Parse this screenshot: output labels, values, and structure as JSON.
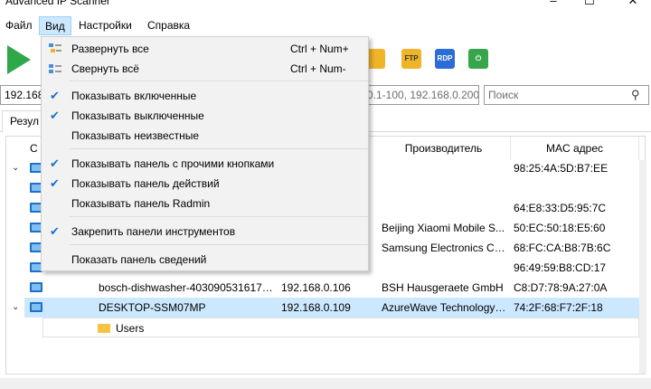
{
  "window": {
    "title": "Advanced IP Scanner"
  },
  "menu": {
    "items": [
      "Файл",
      "Вид",
      "Настройки",
      "Справка"
    ]
  },
  "address": {
    "value": "192.168",
    "hint": "0.1-100, 192.168.0.200",
    "search_placeholder": "Поиск"
  },
  "tabs": [
    "Резул"
  ],
  "table": {
    "headers": [
      "С",
      "",
      "",
      "Производитель",
      "MAC адрес"
    ],
    "rows": [
      {
        "name": "",
        "ip": "",
        "vendor": "",
        "mac": "98:25:4A:5D:B7:EE"
      },
      {
        "name": "",
        "ip": "",
        "vendor": "",
        "mac": ""
      },
      {
        "name": "",
        "ip": "",
        "vendor": "",
        "mac": "64:E8:33:D5:95:7C"
      },
      {
        "name": "",
        "ip": "",
        "vendor": "Beijing Xiaomi Mobile S...",
        "mac": "50:EC:50:18:E5:60"
      },
      {
        "name": "",
        "ip": "",
        "vendor": "Samsung Electronics Co...",
        "mac": "68:FC:CA:B8:7B:6C"
      },
      {
        "name": "",
        "ip": "",
        "vendor": "",
        "mac": "96:49:59:B8:CD:17"
      },
      {
        "name": "bosch-dishwasher-4030905316170...",
        "ip": "192.168.0.106",
        "vendor": "BSH Hausgeraete GmbH",
        "mac": "C8:D7:78:9A:27:0A"
      },
      {
        "name": "DESKTOP-SSM07MP",
        "ip": "192.168.0.109",
        "vendor": "AzureWave Technology I...",
        "mac": "74:2F:68:F7:2F:18"
      }
    ],
    "child": {
      "name": "Users"
    }
  },
  "dropdown": {
    "items": [
      {
        "label": "Развернуть все",
        "shortcut": "Ctrl + Num+",
        "checked": false,
        "icon": "expand-icon"
      },
      {
        "label": "Свернуть всё",
        "shortcut": "Ctrl + Num-",
        "checked": false,
        "icon": "collapse-icon"
      },
      {
        "label": "Показывать включенные",
        "shortcut": "",
        "checked": true
      },
      {
        "label": "Показывать выключенные",
        "shortcut": "",
        "checked": true
      },
      {
        "label": "Показывать неизвестные",
        "shortcut": "",
        "checked": false
      },
      {
        "label": "Показывать панель с прочими кнопками",
        "shortcut": "",
        "checked": true
      },
      {
        "label": "Показывать панель действий",
        "shortcut": "",
        "checked": true
      },
      {
        "label": "Показывать панель Radmin",
        "shortcut": "",
        "checked": false
      },
      {
        "label": "Закрепить панели инструментов",
        "shortcut": "",
        "checked": true
      },
      {
        "label": "Показать панель сведений",
        "shortcut": "",
        "checked": false
      }
    ]
  },
  "toolbar": {
    "icons": [
      "play-icon",
      "ftp-icon",
      "folder-icon",
      "rdp-icon",
      "power-icon"
    ],
    "rdp_text": "RDP",
    "ftp_text": "FTP"
  },
  "colors": {
    "accent": "#1a6fd0",
    "selection": "#cce8ff",
    "play": "#2fa84a"
  }
}
